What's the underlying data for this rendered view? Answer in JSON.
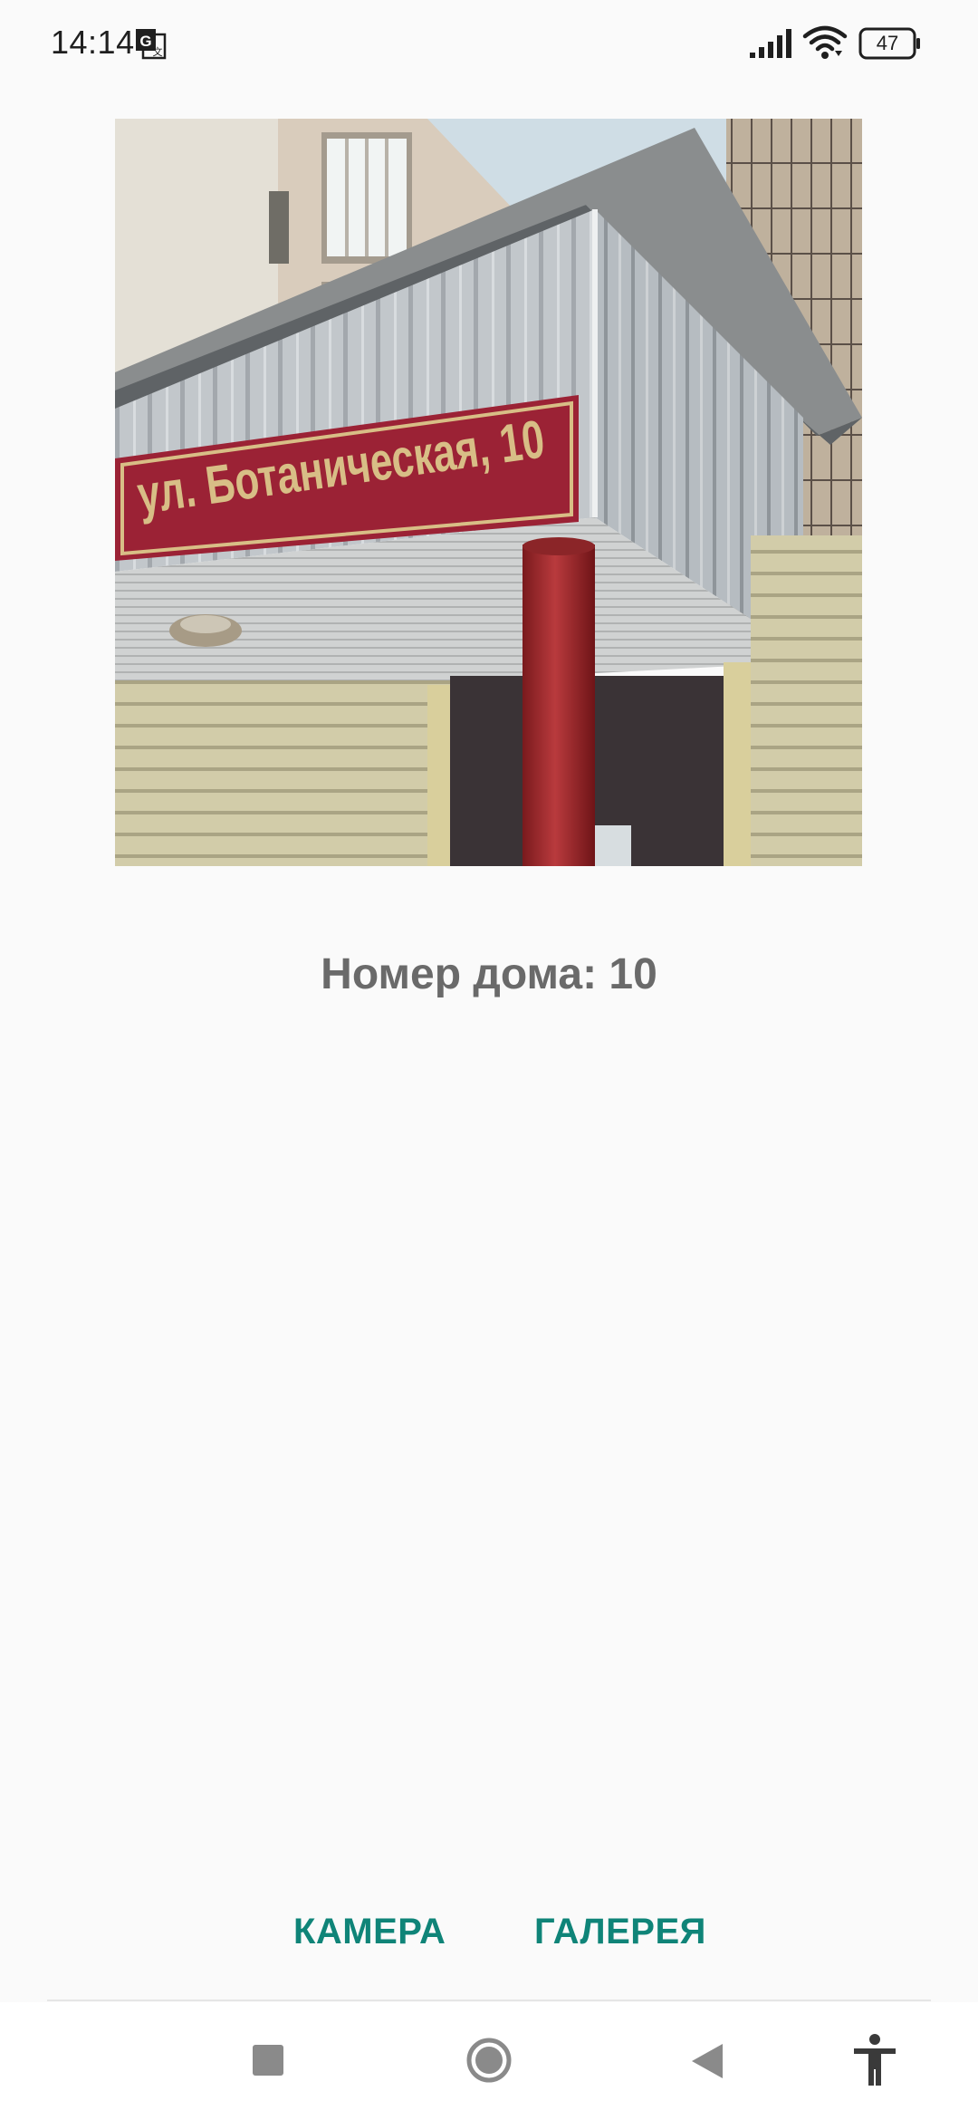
{
  "status_bar": {
    "time": "14:14",
    "battery_level": "47",
    "icons": [
      "translate-icon",
      "signal-icon",
      "wifi-icon",
      "battery-icon"
    ]
  },
  "photo": {
    "sign_text": "ул. Ботаническая, 10"
  },
  "result": {
    "text": "Номер дома: 10"
  },
  "actions": {
    "camera_label": "КАМЕРА",
    "gallery_label": "ГАЛЕРЕЯ"
  },
  "nav_bar": {
    "icons": [
      "recents-icon",
      "home-icon",
      "back-icon",
      "accessibility-icon"
    ]
  },
  "colors": {
    "accent": "#0f8478",
    "result_text": "#6a6a6a",
    "background": "#fafafa",
    "sign_background": "#9b2235",
    "sign_text": "#d8be86"
  }
}
